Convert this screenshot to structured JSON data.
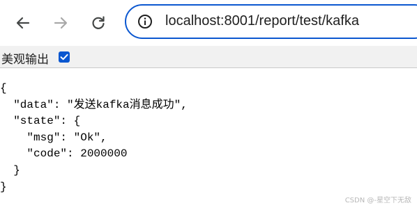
{
  "browser": {
    "url": "localhost:8001/report/test/kafka",
    "icons": {
      "back": "arrow-left-icon",
      "forward": "arrow-right-icon",
      "reload": "reload-icon",
      "site_info": "info-icon"
    },
    "colors": {
      "accent": "#0b57d0",
      "forward_disabled": "#a8a8a8"
    }
  },
  "pretty_print": {
    "label": "美观输出",
    "checked": true
  },
  "json_lines": [
    "{",
    "  \"data\": \"发送kafka消息成功\",",
    "  \"state\": {",
    "    \"msg\": \"Ok\",",
    "    \"code\": 2000000",
    "  }",
    "}"
  ],
  "watermark": "CSDN @-星空下无敌"
}
